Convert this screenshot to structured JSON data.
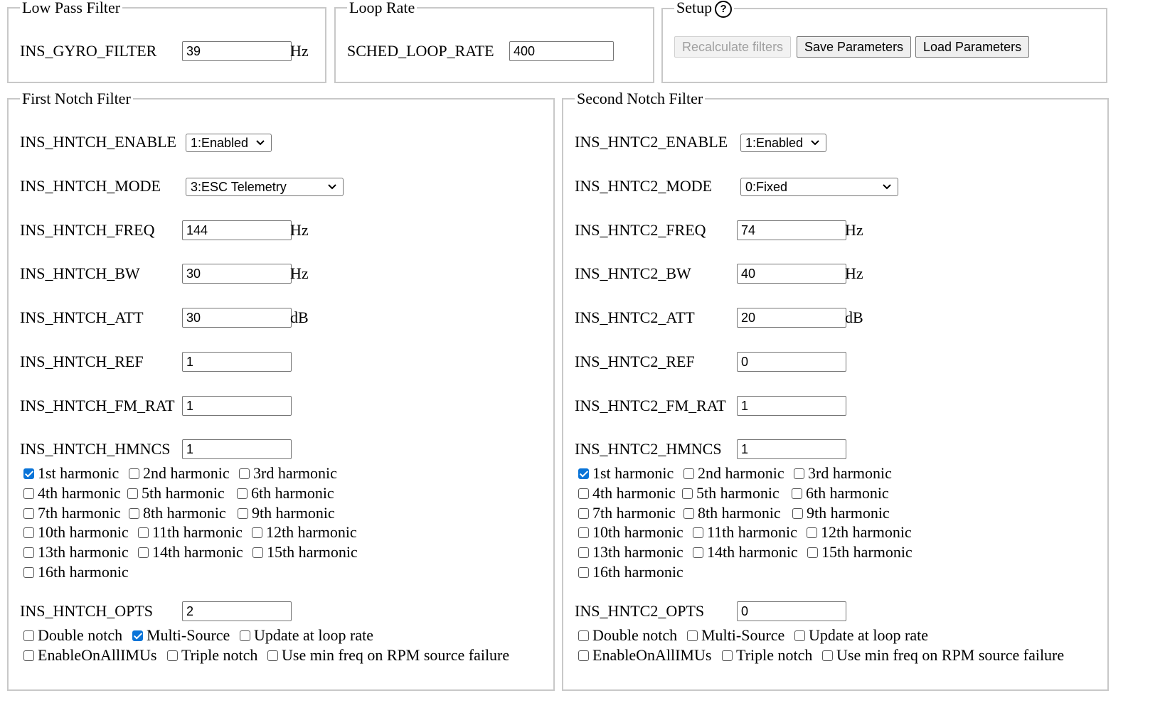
{
  "low_pass": {
    "legend": "Low Pass Filter",
    "label": "INS_GYRO_FILTER",
    "value": "39",
    "unit": "Hz"
  },
  "loop_rate": {
    "legend": "Loop Rate",
    "label": "SCHED_LOOP_RATE",
    "value": "400"
  },
  "setup": {
    "legend": "Setup",
    "help_glyph": "?",
    "recalc": "Recalculate filters",
    "save": "Save Parameters",
    "load": "Load Parameters"
  },
  "notch1": {
    "legend": "First Notch Filter",
    "enable": {
      "label": "INS_HNTCH_ENABLE",
      "value": "1:Enabled"
    },
    "mode": {
      "label": "INS_HNTCH_MODE",
      "value": "3:ESC Telemetry"
    },
    "freq": {
      "label": "INS_HNTCH_FREQ",
      "value": "144",
      "unit": "Hz"
    },
    "bw": {
      "label": "INS_HNTCH_BW",
      "value": "30",
      "unit": "Hz"
    },
    "att": {
      "label": "INS_HNTCH_ATT",
      "value": "30",
      "unit": "dB"
    },
    "ref": {
      "label": "INS_HNTCH_REF",
      "value": "1"
    },
    "fm_rat": {
      "label": "INS_HNTCH_FM_RAT",
      "value": "1"
    },
    "hmncs": {
      "label": "INS_HNTCH_HMNCS",
      "value": "1"
    },
    "harmonics": [
      {
        "label": "1st harmonic",
        "checked": true
      },
      {
        "label": "2nd harmonic",
        "checked": false
      },
      {
        "label": "3rd harmonic",
        "checked": false
      },
      {
        "label": "4th harmonic",
        "checked": false
      },
      {
        "label": "5th harmonic",
        "checked": false
      },
      {
        "label": "6th harmonic",
        "checked": false
      },
      {
        "label": "7th harmonic",
        "checked": false
      },
      {
        "label": "8th harmonic",
        "checked": false
      },
      {
        "label": "9th harmonic",
        "checked": false
      },
      {
        "label": "10th harmonic",
        "checked": false
      },
      {
        "label": "11th harmonic",
        "checked": false
      },
      {
        "label": "12th harmonic",
        "checked": false
      },
      {
        "label": "13th harmonic",
        "checked": false
      },
      {
        "label": "14th harmonic",
        "checked": false
      },
      {
        "label": "15th harmonic",
        "checked": false
      },
      {
        "label": "16th harmonic",
        "checked": false
      }
    ],
    "opts": {
      "label": "INS_HNTCH_OPTS",
      "value": "2"
    },
    "options": [
      {
        "label": "Double notch",
        "checked": false
      },
      {
        "label": "Multi-Source",
        "checked": true
      },
      {
        "label": "Update at loop rate",
        "checked": false
      },
      {
        "label": "EnableOnAllIMUs",
        "checked": false
      },
      {
        "label": "Triple notch",
        "checked": false
      },
      {
        "label": "Use min freq on RPM source failure",
        "checked": false
      }
    ]
  },
  "notch2": {
    "legend": "Second Notch Filter",
    "enable": {
      "label": "INS_HNTC2_ENABLE",
      "value": "1:Enabled"
    },
    "mode": {
      "label": "INS_HNTC2_MODE",
      "value": "0:Fixed"
    },
    "freq": {
      "label": "INS_HNTC2_FREQ",
      "value": "74",
      "unit": "Hz"
    },
    "bw": {
      "label": "INS_HNTC2_BW",
      "value": "40",
      "unit": "Hz"
    },
    "att": {
      "label": "INS_HNTC2_ATT",
      "value": "20",
      "unit": "dB"
    },
    "ref": {
      "label": "INS_HNTC2_REF",
      "value": "0"
    },
    "fm_rat": {
      "label": "INS_HNTC2_FM_RAT",
      "value": "1"
    },
    "hmncs": {
      "label": "INS_HNTC2_HMNCS",
      "value": "1"
    },
    "harmonics": [
      {
        "label": "1st harmonic",
        "checked": true
      },
      {
        "label": "2nd harmonic",
        "checked": false
      },
      {
        "label": "3rd harmonic",
        "checked": false
      },
      {
        "label": "4th harmonic",
        "checked": false
      },
      {
        "label": "5th harmonic",
        "checked": false
      },
      {
        "label": "6th harmonic",
        "checked": false
      },
      {
        "label": "7th harmonic",
        "checked": false
      },
      {
        "label": "8th harmonic",
        "checked": false
      },
      {
        "label": "9th harmonic",
        "checked": false
      },
      {
        "label": "10th harmonic",
        "checked": false
      },
      {
        "label": "11th harmonic",
        "checked": false
      },
      {
        "label": "12th harmonic",
        "checked": false
      },
      {
        "label": "13th harmonic",
        "checked": false
      },
      {
        "label": "14th harmonic",
        "checked": false
      },
      {
        "label": "15th harmonic",
        "checked": false
      },
      {
        "label": "16th harmonic",
        "checked": false
      }
    ],
    "opts": {
      "label": "INS_HNTC2_OPTS",
      "value": "0"
    },
    "options": [
      {
        "label": "Double notch",
        "checked": false
      },
      {
        "label": "Multi-Source",
        "checked": false
      },
      {
        "label": "Update at loop rate",
        "checked": false
      },
      {
        "label": "EnableOnAllIMUs",
        "checked": false
      },
      {
        "label": "Triple notch",
        "checked": false
      },
      {
        "label": "Use min freq on RPM source failure",
        "checked": false
      }
    ]
  }
}
